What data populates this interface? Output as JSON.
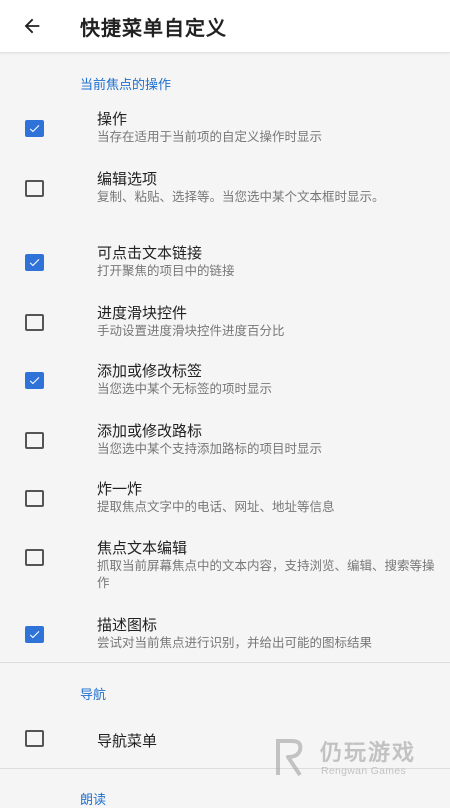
{
  "header": {
    "title": "快捷菜单自定义",
    "back_icon": "arrow-left-icon"
  },
  "sections": {
    "focus": "当前焦点的操作",
    "navigation": "导航",
    "read": "朗读"
  },
  "items": [
    {
      "title": "操作",
      "subtitle": "当存在适用于当前项的自定义操作时显示",
      "checked": true
    },
    {
      "title": "编辑选项",
      "subtitle": "复制、粘贴、选择等。当您选中某个文本框时显示。",
      "checked": false
    },
    {
      "title": "可点击文本链接",
      "subtitle": "打开聚焦的项目中的链接",
      "checked": true
    },
    {
      "title": "进度滑块控件",
      "subtitle": "手动设置进度滑块控件进度百分比",
      "checked": false
    },
    {
      "title": "添加或修改标签",
      "subtitle": "当您选中某个无标签的项时显示",
      "checked": true
    },
    {
      "title": "添加或修改路标",
      "subtitle": "当您选中某个支持添加路标的项目时显示",
      "checked": false
    },
    {
      "title": "炸一炸",
      "subtitle": "提取焦点文字中的电话、网址、地址等信息",
      "checked": false
    },
    {
      "title": "焦点文本编辑",
      "subtitle": "抓取当前屏幕焦点中的文本内容，支持浏览、编辑、搜索等操作",
      "checked": false
    },
    {
      "title": "描述图标",
      "subtitle": "尝试对当前焦点进行识别，并给出可能的图标结果",
      "checked": true
    }
  ],
  "nav_item": {
    "title": "导航菜单",
    "checked": false
  },
  "watermark": {
    "text": "仍玩游戏",
    "sub": "Rengwan Games"
  },
  "colors": {
    "accent": "#2f73d9",
    "section": "#1e6fcf"
  }
}
